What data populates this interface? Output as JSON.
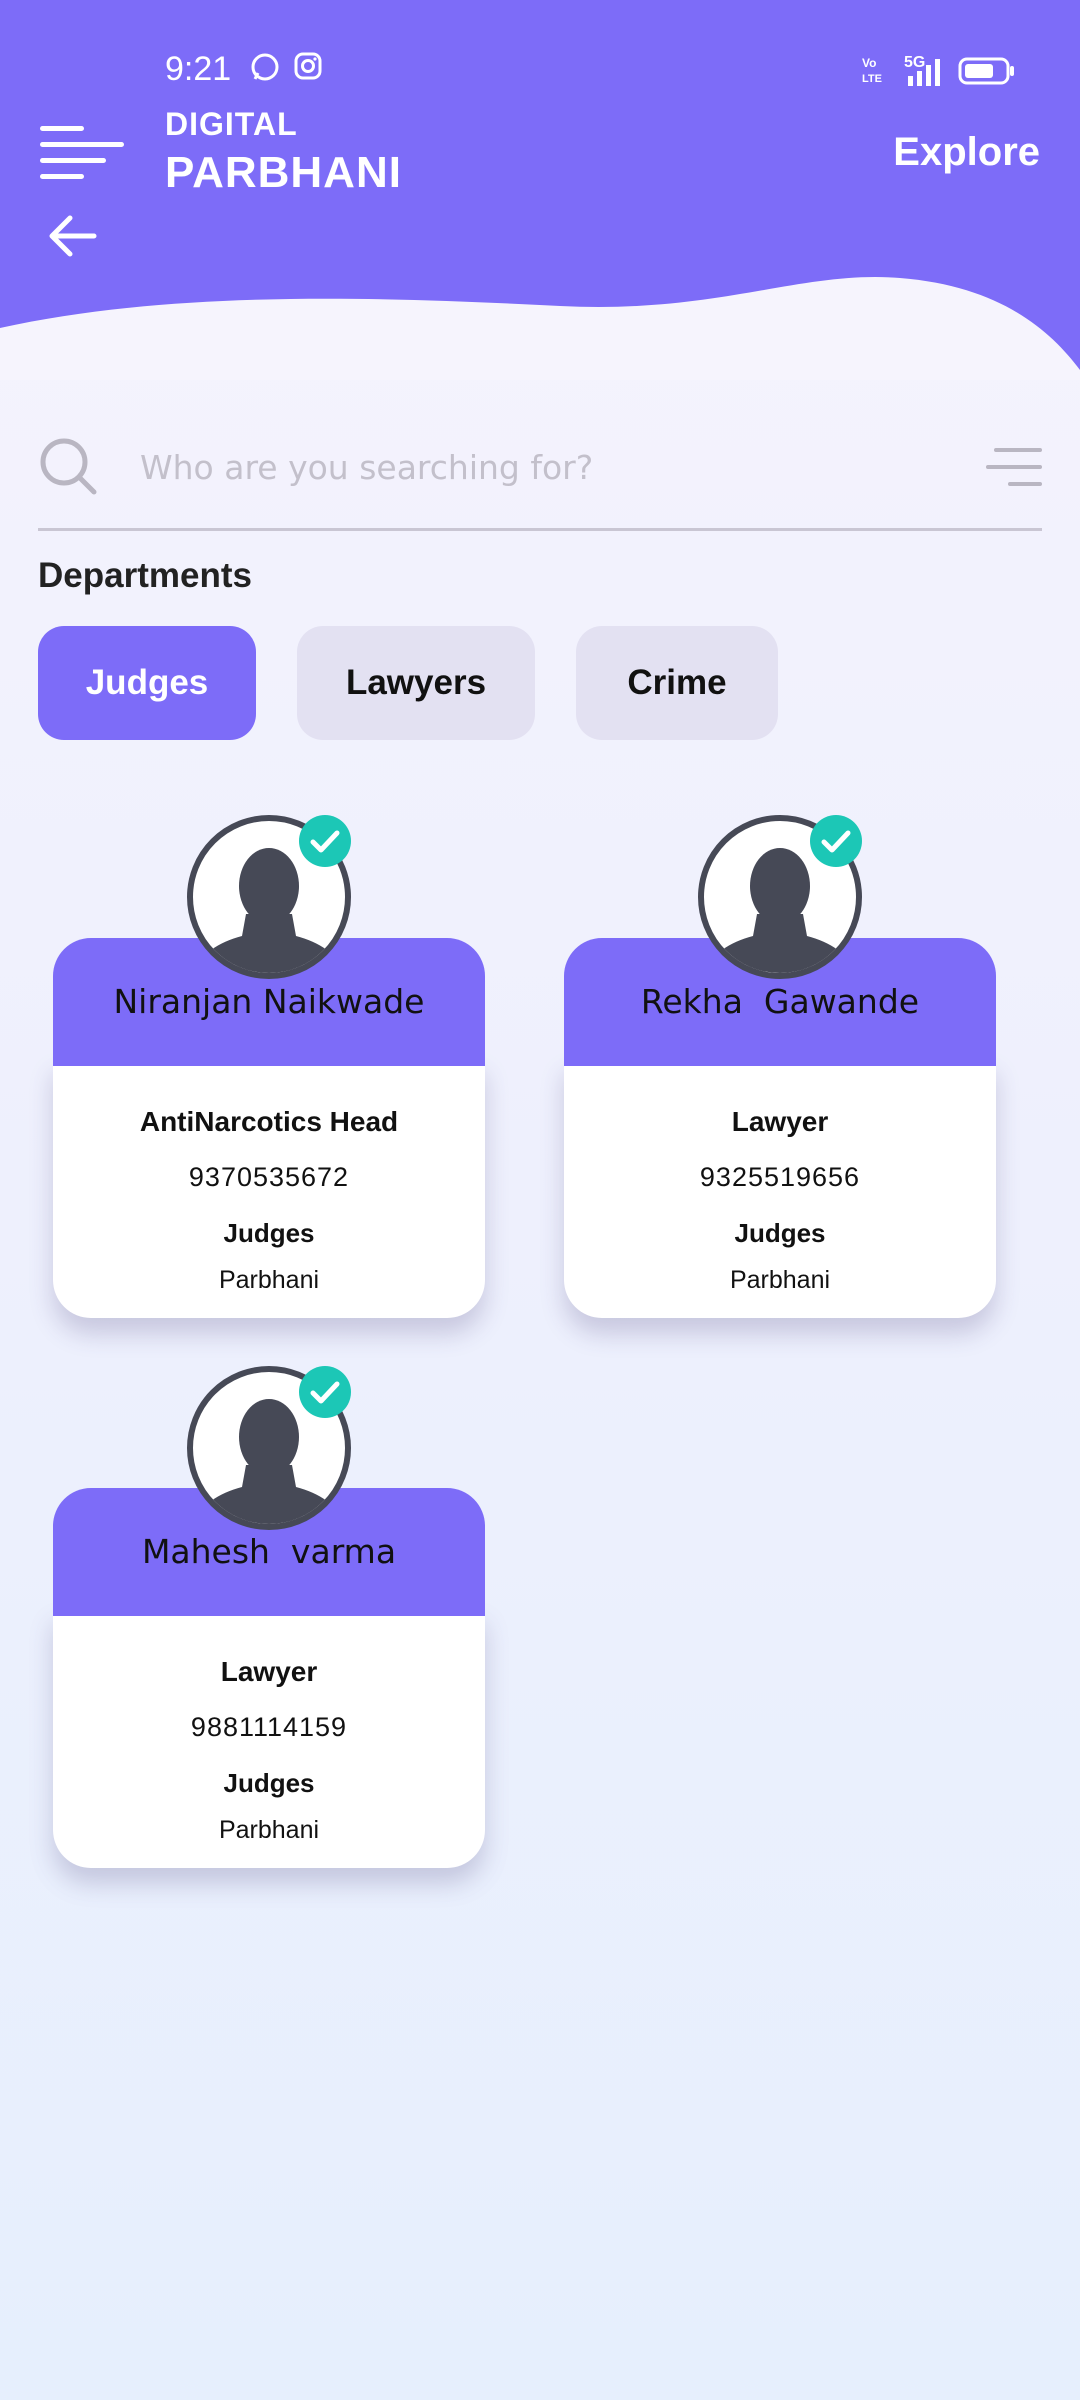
{
  "status_bar": {
    "time": "9:21",
    "network": "5G"
  },
  "header": {
    "app_subtitle": "DIGITAL",
    "app_title": "PARBHANI",
    "explore_label": "Explore"
  },
  "search": {
    "placeholder": "Who are you searching for?",
    "value": ""
  },
  "departments": {
    "heading": "Departments",
    "tabs": [
      {
        "label": "Judges",
        "active": true
      },
      {
        "label": "Lawyers",
        "active": false
      },
      {
        "label": "Crime",
        "active": false
      }
    ]
  },
  "people": [
    {
      "name": "Niranjan Naikwade",
      "role": "AntiNarcotics Head",
      "phone": "9370535672",
      "department": "Judges",
      "city": "Parbhani",
      "verified": true
    },
    {
      "name": "Rekha  Gawande",
      "role": "Lawyer",
      "phone": "9325519656",
      "department": "Judges",
      "city": "Parbhani",
      "verified": true
    },
    {
      "name": "Mahesh  varma",
      "role": "Lawyer",
      "phone": "9881114159",
      "department": "Judges",
      "city": "Parbhani",
      "verified": true
    }
  ],
  "colors": {
    "accent": "#7d6cf8",
    "tab_inactive": "#e3e1f2",
    "verified": "#1cc7b6",
    "avatar": "#464956"
  }
}
